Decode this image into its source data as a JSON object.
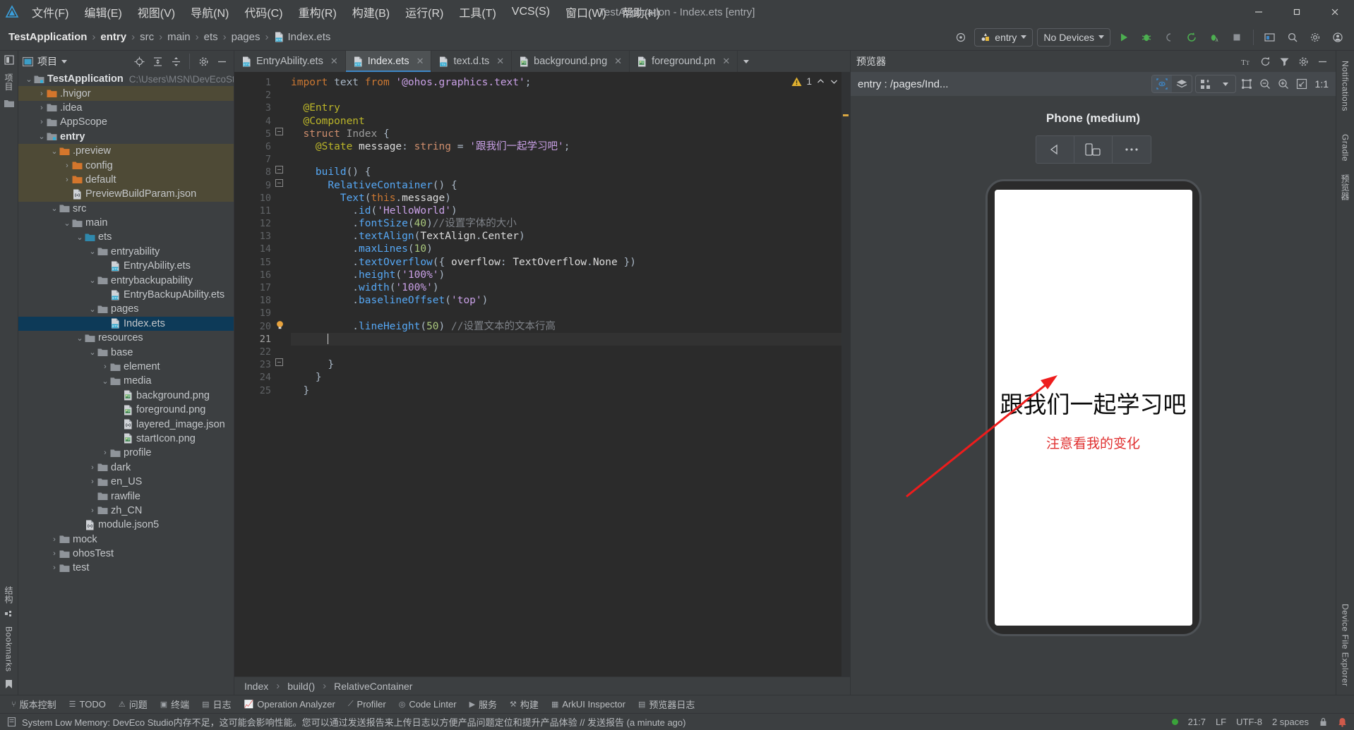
{
  "window": {
    "title": "TestApplication - Index.ets [entry]",
    "minimize": "—",
    "maximize": "❐",
    "close": "✕"
  },
  "menu": {
    "items": [
      {
        "label": "文件(F)",
        "name": "menu-file"
      },
      {
        "label": "编辑(E)",
        "name": "menu-edit"
      },
      {
        "label": "视图(V)",
        "name": "menu-view"
      },
      {
        "label": "导航(N)",
        "name": "menu-navigate"
      },
      {
        "label": "代码(C)",
        "name": "menu-code"
      },
      {
        "label": "重构(R)",
        "name": "menu-refactor"
      },
      {
        "label": "构建(B)",
        "name": "menu-build"
      },
      {
        "label": "运行(R)",
        "name": "menu-run"
      },
      {
        "label": "工具(T)",
        "name": "menu-tools"
      },
      {
        "label": "VCS(S)",
        "name": "menu-vcs"
      },
      {
        "label": "窗口(W)",
        "name": "menu-window"
      },
      {
        "label": "帮助(H)",
        "name": "menu-help"
      }
    ]
  },
  "breadcrumbs": {
    "items": [
      "TestApplication",
      "entry",
      "src",
      "main",
      "ets",
      "pages"
    ],
    "file": "Index.ets",
    "separator": "›"
  },
  "toolbar": {
    "run_config": "entry",
    "device": "No Devices",
    "icons": [
      {
        "name": "target-icon",
        "title": "选择设备"
      },
      {
        "name": "run-icon",
        "title": "运行"
      },
      {
        "name": "debug-icon",
        "title": "调试"
      },
      {
        "name": "attach-icon",
        "title": "附加"
      },
      {
        "name": "rerun-icon",
        "title": "重新运行"
      },
      {
        "name": "profile-icon",
        "title": "分析"
      },
      {
        "name": "stop-icon",
        "title": "停止"
      },
      {
        "name": "project-structure-icon",
        "title": "项目结构"
      },
      {
        "name": "search-icon",
        "title": "搜索"
      },
      {
        "name": "settings-icon",
        "title": "设置"
      },
      {
        "name": "account-icon",
        "title": "账户"
      }
    ]
  },
  "project_panel": {
    "title": "项目",
    "header_icons": [
      "locate-icon",
      "expand-all-icon",
      "collapse-all-icon",
      "gear-icon",
      "hide-icon"
    ],
    "tree": [
      {
        "depth": 0,
        "arrow": "v",
        "icon": "module-folder",
        "label": "TestApplication",
        "path": "C:\\Users\\MSN\\DevEcoStu",
        "bold": true,
        "state": "normal"
      },
      {
        "depth": 1,
        "arrow": ">",
        "icon": "folder-orange",
        "label": ".hvigor",
        "state": "highlight"
      },
      {
        "depth": 1,
        "arrow": ">",
        "icon": "folder",
        "label": ".idea",
        "state": "normal"
      },
      {
        "depth": 1,
        "arrow": ">",
        "icon": "folder",
        "label": "AppScope",
        "state": "normal"
      },
      {
        "depth": 1,
        "arrow": "v",
        "icon": "module-folder",
        "label": "entry",
        "bold": true,
        "state": "normal"
      },
      {
        "depth": 2,
        "arrow": "v",
        "icon": "folder-orange",
        "label": ".preview",
        "state": "highlight"
      },
      {
        "depth": 3,
        "arrow": ">",
        "icon": "folder-orange",
        "label": "config",
        "state": "highlight"
      },
      {
        "depth": 3,
        "arrow": ">",
        "icon": "folder-orange",
        "label": "default",
        "state": "highlight"
      },
      {
        "depth": 3,
        "arrow": "",
        "icon": "json-file",
        "label": "PreviewBuildParam.json",
        "state": "highlight"
      },
      {
        "depth": 2,
        "arrow": "v",
        "icon": "folder",
        "label": "src",
        "state": "normal"
      },
      {
        "depth": 3,
        "arrow": "v",
        "icon": "folder",
        "label": "main",
        "state": "normal"
      },
      {
        "depth": 4,
        "arrow": "v",
        "icon": "folder-blue",
        "label": "ets",
        "state": "normal"
      },
      {
        "depth": 5,
        "arrow": "v",
        "icon": "folder",
        "label": "entryability",
        "state": "normal"
      },
      {
        "depth": 6,
        "arrow": "",
        "icon": "ets-file",
        "label": "EntryAbility.ets",
        "state": "normal"
      },
      {
        "depth": 5,
        "arrow": "v",
        "icon": "folder",
        "label": "entrybackupability",
        "state": "normal"
      },
      {
        "depth": 6,
        "arrow": "",
        "icon": "ets-file",
        "label": "EntryBackupAbility.ets",
        "state": "normal"
      },
      {
        "depth": 5,
        "arrow": "v",
        "icon": "folder",
        "label": "pages",
        "state": "normal"
      },
      {
        "depth": 6,
        "arrow": "",
        "icon": "ets-file",
        "label": "Index.ets",
        "state": "selected"
      },
      {
        "depth": 4,
        "arrow": "v",
        "icon": "folder",
        "label": "resources",
        "state": "normal"
      },
      {
        "depth": 5,
        "arrow": "v",
        "icon": "folder",
        "label": "base",
        "state": "normal"
      },
      {
        "depth": 6,
        "arrow": ">",
        "icon": "folder",
        "label": "element",
        "state": "normal"
      },
      {
        "depth": 6,
        "arrow": "v",
        "icon": "folder",
        "label": "media",
        "state": "normal"
      },
      {
        "depth": 7,
        "arrow": "",
        "icon": "png-file",
        "label": "background.png",
        "state": "normal"
      },
      {
        "depth": 7,
        "arrow": "",
        "icon": "png-file",
        "label": "foreground.png",
        "state": "normal"
      },
      {
        "depth": 7,
        "arrow": "",
        "icon": "json-file",
        "label": "layered_image.json",
        "state": "normal"
      },
      {
        "depth": 7,
        "arrow": "",
        "icon": "png-file",
        "label": "startIcon.png",
        "state": "normal"
      },
      {
        "depth": 6,
        "arrow": ">",
        "icon": "folder",
        "label": "profile",
        "state": "normal"
      },
      {
        "depth": 5,
        "arrow": ">",
        "icon": "folder",
        "label": "dark",
        "state": "normal"
      },
      {
        "depth": 5,
        "arrow": ">",
        "icon": "folder",
        "label": "en_US",
        "state": "normal"
      },
      {
        "depth": 5,
        "arrow": "",
        "icon": "folder",
        "label": "rawfile",
        "state": "normal"
      },
      {
        "depth": 5,
        "arrow": ">",
        "icon": "folder",
        "label": "zh_CN",
        "state": "normal"
      },
      {
        "depth": 4,
        "arrow": "",
        "icon": "json-file",
        "label": "module.json5",
        "state": "normal"
      },
      {
        "depth": 2,
        "arrow": ">",
        "icon": "folder",
        "label": "mock",
        "state": "normal"
      },
      {
        "depth": 2,
        "arrow": ">",
        "icon": "folder",
        "label": "ohosTest",
        "state": "normal"
      },
      {
        "depth": 2,
        "arrow": ">",
        "icon": "folder",
        "label": "test",
        "state": "normal"
      }
    ]
  },
  "left_rail": {
    "top_label": "项目",
    "bottom_labels": [
      "结构",
      "Bookmarks"
    ]
  },
  "right_rail": {
    "labels": [
      "Notifications",
      "Gradle",
      "预览器",
      "Device File Explorer"
    ]
  },
  "editor": {
    "tabs": [
      {
        "label": "EntryAbility.ets",
        "icon": "ets-file",
        "active": false
      },
      {
        "label": "Index.ets",
        "icon": "ets-file",
        "active": true
      },
      {
        "label": "text.d.ts",
        "icon": "ts-file",
        "active": false
      },
      {
        "label": "background.png",
        "icon": "png-file",
        "active": false
      },
      {
        "label": "foreground.pn",
        "icon": "png-file",
        "active": false
      }
    ],
    "warning_count": "1",
    "current_line": 21,
    "total_lines": 25,
    "breadcrumb": [
      "Index",
      "build()",
      "RelativeContainer"
    ],
    "lines": [
      {
        "n": 1,
        "fold": "",
        "tokens": [
          {
            "t": "import ",
            "c": "kw"
          },
          {
            "t": "text",
            "c": "def"
          },
          {
            "t": " from ",
            "c": "kw"
          },
          {
            "t": "'@ohos.graphics.text'",
            "c": "str"
          },
          {
            "t": ";",
            "c": "punc"
          }
        ]
      },
      {
        "n": 2,
        "fold": "",
        "tokens": []
      },
      {
        "n": 3,
        "fold": "",
        "tokens": [
          {
            "t": "  ",
            "c": "punc"
          },
          {
            "t": "@Entry",
            "c": "deco"
          }
        ]
      },
      {
        "n": 4,
        "fold": "",
        "tokens": [
          {
            "t": "  ",
            "c": "punc"
          },
          {
            "t": "@Component",
            "c": "deco"
          }
        ]
      },
      {
        "n": 5,
        "fold": "-",
        "tokens": [
          {
            "t": "  ",
            "c": "punc"
          },
          {
            "t": "struct",
            "c": "kw2"
          },
          {
            "t": " ",
            "c": "punc"
          },
          {
            "t": "Index",
            "c": "type"
          },
          {
            "t": " {",
            "c": "punc"
          }
        ]
      },
      {
        "n": 6,
        "fold": "",
        "tokens": [
          {
            "t": "    ",
            "c": "punc"
          },
          {
            "t": "@State",
            "c": "deco"
          },
          {
            "t": " ",
            "c": "punc"
          },
          {
            "t": "message",
            "c": "white"
          },
          {
            "t": ": ",
            "c": "punc"
          },
          {
            "t": "string",
            "c": "kw2"
          },
          {
            "t": " = ",
            "c": "punc"
          },
          {
            "t": "'跟我们一起学习吧'",
            "c": "str"
          },
          {
            "t": ";",
            "c": "punc"
          }
        ]
      },
      {
        "n": 7,
        "fold": "",
        "tokens": []
      },
      {
        "n": 8,
        "fold": "-",
        "tokens": [
          {
            "t": "    ",
            "c": "punc"
          },
          {
            "t": "build",
            "c": "fn"
          },
          {
            "t": "() {",
            "c": "punc"
          }
        ]
      },
      {
        "n": 9,
        "fold": "-",
        "tokens": [
          {
            "t": "      ",
            "c": "punc"
          },
          {
            "t": "RelativeContainer",
            "c": "fn"
          },
          {
            "t": "() {",
            "c": "punc"
          }
        ]
      },
      {
        "n": 10,
        "fold": "",
        "tokens": [
          {
            "t": "        ",
            "c": "punc"
          },
          {
            "t": "Text",
            "c": "fn"
          },
          {
            "t": "(",
            "c": "punc"
          },
          {
            "t": "this",
            "c": "kw"
          },
          {
            "t": ".",
            "c": "punc"
          },
          {
            "t": "message",
            "c": "white"
          },
          {
            "t": ")",
            "c": "punc"
          }
        ]
      },
      {
        "n": 11,
        "fold": "",
        "tokens": [
          {
            "t": "          .",
            "c": "punc"
          },
          {
            "t": "id",
            "c": "fn"
          },
          {
            "t": "(",
            "c": "punc"
          },
          {
            "t": "'HelloWorld'",
            "c": "str"
          },
          {
            "t": ")",
            "c": "punc"
          }
        ]
      },
      {
        "n": 12,
        "fold": "",
        "tokens": [
          {
            "t": "          .",
            "c": "punc"
          },
          {
            "t": "fontSize",
            "c": "fn"
          },
          {
            "t": "(",
            "c": "punc"
          },
          {
            "t": "40",
            "c": "num"
          },
          {
            "t": ")",
            "c": "punc"
          },
          {
            "t": "//设置字体的大小",
            "c": "cmt"
          }
        ]
      },
      {
        "n": 13,
        "fold": "",
        "tokens": [
          {
            "t": "          .",
            "c": "punc"
          },
          {
            "t": "textAlign",
            "c": "fn"
          },
          {
            "t": "(",
            "c": "punc"
          },
          {
            "t": "TextAlign",
            "c": "white"
          },
          {
            "t": ".",
            "c": "punc"
          },
          {
            "t": "Center",
            "c": "white"
          },
          {
            "t": ")",
            "c": "punc"
          }
        ]
      },
      {
        "n": 14,
        "fold": "",
        "tokens": [
          {
            "t": "          .",
            "c": "punc"
          },
          {
            "t": "maxLines",
            "c": "fn"
          },
          {
            "t": "(",
            "c": "punc"
          },
          {
            "t": "10",
            "c": "num"
          },
          {
            "t": ")",
            "c": "punc"
          }
        ]
      },
      {
        "n": 15,
        "fold": "",
        "tokens": [
          {
            "t": "          .",
            "c": "punc"
          },
          {
            "t": "textOverflow",
            "c": "fn"
          },
          {
            "t": "({ ",
            "c": "punc"
          },
          {
            "t": "overflow",
            "c": "white"
          },
          {
            "t": ": ",
            "c": "punc"
          },
          {
            "t": "TextOverflow",
            "c": "white"
          },
          {
            "t": ".",
            "c": "punc"
          },
          {
            "t": "None",
            "c": "white"
          },
          {
            "t": " })",
            "c": "punc"
          }
        ]
      },
      {
        "n": 16,
        "fold": "",
        "tokens": [
          {
            "t": "          .",
            "c": "punc"
          },
          {
            "t": "height",
            "c": "fn"
          },
          {
            "t": "(",
            "c": "punc"
          },
          {
            "t": "'100%'",
            "c": "str"
          },
          {
            "t": ")",
            "c": "punc"
          }
        ]
      },
      {
        "n": 17,
        "fold": "",
        "tokens": [
          {
            "t": "          .",
            "c": "punc"
          },
          {
            "t": "width",
            "c": "fn"
          },
          {
            "t": "(",
            "c": "punc"
          },
          {
            "t": "'100%'",
            "c": "str"
          },
          {
            "t": ")",
            "c": "punc"
          }
        ]
      },
      {
        "n": 18,
        "fold": "",
        "tokens": [
          {
            "t": "          .",
            "c": "punc"
          },
          {
            "t": "baselineOffset",
            "c": "fn"
          },
          {
            "t": "(",
            "c": "punc"
          },
          {
            "t": "'top'",
            "c": "str"
          },
          {
            "t": ")",
            "c": "punc"
          }
        ]
      },
      {
        "n": 19,
        "fold": "",
        "tokens": []
      },
      {
        "n": 20,
        "fold": "",
        "bulb": true,
        "tokens": [
          {
            "t": "          .",
            "c": "punc"
          },
          {
            "t": "lineHeight",
            "c": "fn"
          },
          {
            "t": "(",
            "c": "punc"
          },
          {
            "t": "50",
            "c": "num"
          },
          {
            "t": ") ",
            "c": "punc"
          },
          {
            "t": "//设置文本的文本行高",
            "c": "cmt"
          }
        ]
      },
      {
        "n": 21,
        "fold": "",
        "cursor": true,
        "tokens": [
          {
            "t": "      ",
            "c": "punc"
          }
        ]
      },
      {
        "n": 22,
        "fold": "",
        "tokens": []
      },
      {
        "n": 23,
        "fold": "-",
        "tokens": [
          {
            "t": "      }",
            "c": "punc"
          }
        ]
      },
      {
        "n": 24,
        "fold": "",
        "tokens": [
          {
            "t": "    }",
            "c": "punc"
          }
        ]
      },
      {
        "n": 25,
        "fold": "",
        "tokens": [
          {
            "t": "  }",
            "c": "punc"
          }
        ]
      }
    ]
  },
  "preview": {
    "title": "预览器",
    "route": "entry : /pages/Ind...",
    "zoom_label": "1:1",
    "device_name": "Phone (medium)",
    "header_icons": [
      "font-size-icon",
      "refresh-icon",
      "filter-icon",
      "gear-icon",
      "hide-icon"
    ],
    "toolbar_icons": [
      "inspector-icon",
      "layers-icon",
      "grid-icon",
      "chevron-down-icon",
      "select-icon",
      "zoom-out-icon",
      "zoom-in-icon",
      "fit-icon"
    ],
    "device_controls": [
      "rotate-left-icon",
      "orientation-icon",
      "more-icon"
    ],
    "screen_text": "跟我们一起学习吧",
    "screen_note": "注意看我的变化",
    "note_color": "#e03030"
  },
  "bottom_tools": [
    {
      "label": "版本控制",
      "icon": "branch-icon"
    },
    {
      "label": "TODO",
      "icon": "list-icon"
    },
    {
      "label": "问题",
      "icon": "warning-icon"
    },
    {
      "label": "终端",
      "icon": "terminal-icon"
    },
    {
      "label": "日志",
      "icon": "log-icon"
    },
    {
      "label": "Operation Analyzer",
      "icon": "chart-icon"
    },
    {
      "label": "Profiler",
      "icon": "profiler-icon"
    },
    {
      "label": "Code Linter",
      "icon": "linter-icon"
    },
    {
      "label": "服务",
      "icon": "services-icon"
    },
    {
      "label": "构建",
      "icon": "hammer-icon"
    },
    {
      "label": "ArkUI Inspector",
      "icon": "inspector-icon"
    },
    {
      "label": "预览器日志",
      "icon": "preview-log-icon"
    }
  ],
  "statusbar": {
    "message": "System Low Memory: DevEco Studio内存不足，这可能会影响性能。您可以通过发送报告来上传日志以方便产品问题定位和提升产品体验 // 发送报告 (a minute ago)",
    "position": "21:7",
    "line_sep": "LF",
    "encoding": "UTF-8",
    "indent": "2 spaces"
  }
}
